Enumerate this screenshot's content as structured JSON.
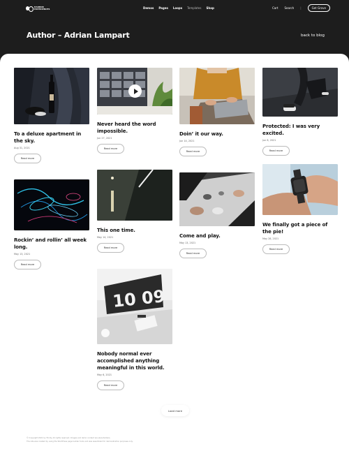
{
  "brand": {
    "line1": "HARBOR",
    "line2": "EXPERIENCES"
  },
  "nav": {
    "items": [
      {
        "label": "Demos"
      },
      {
        "label": "Pages"
      },
      {
        "label": "Loops"
      },
      {
        "label": "Templates"
      },
      {
        "label": "Shop"
      }
    ],
    "cart": "Cart",
    "search": "Search",
    "divider": "|",
    "cta": "Get Grove"
  },
  "header": {
    "title": "Author – Adrian Lampart",
    "back_link": "back to blog"
  },
  "read_more_label": "Read more",
  "posts": [
    {
      "title": "To a deluxe apartment in the sky.",
      "date": "Aug 31, 2021"
    },
    {
      "title": "Rockin’ and rollin’ all week long.",
      "date": "May 13, 2021"
    },
    {
      "title": "Never heard the word impossible.",
      "date": "Jun 27, 2021"
    },
    {
      "title": "This one time.",
      "date": "May 14, 2021"
    },
    {
      "title": "Nobody normal ever accomplished anything meaningful in this world.",
      "date": "May 6, 2021"
    },
    {
      "title": "Doin’ it our way.",
      "date": "Jun 14, 2021"
    },
    {
      "title": "Come and play.",
      "date": "May 13, 2021"
    },
    {
      "title": "Protected: I was very excited.",
      "date": "Jun 8, 2021"
    },
    {
      "title": "We finally got a piece of the pie!",
      "date": "May 28, 2021"
    }
  ],
  "load_more": "Load more",
  "footer": {
    "line1": "© Copyright 2021 by Trinity. All rights reserved. Images and demo content are placeholders.",
    "line2": "The site was created by using the WordPress page builder tools and was assembled for demonstration purposes only."
  }
}
